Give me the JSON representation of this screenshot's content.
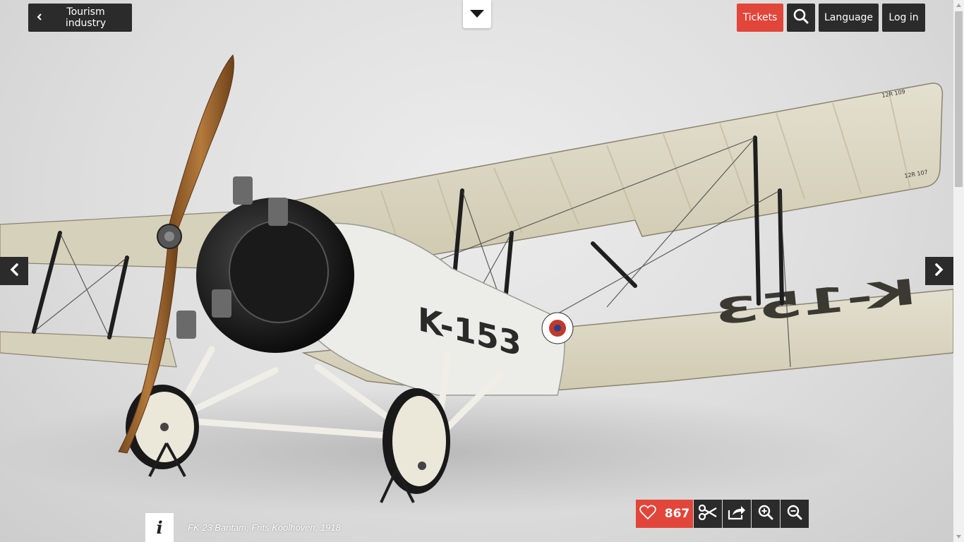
{
  "header": {
    "back_label": "Tourism industry",
    "tickets_label": "Tickets",
    "language_label": "Language",
    "login_label": "Log in"
  },
  "artwork": {
    "caption": "FK 23 Bantam, Frits Koolhoven, 1918"
  },
  "toolbar": {
    "like_count": "867"
  },
  "colors": {
    "accent": "#e2453a",
    "button_dark": "#2b2b2b"
  },
  "icons": [
    "chevron-left-icon",
    "search-icon",
    "caret-down-icon",
    "arrow-left-icon",
    "arrow-right-icon",
    "info-icon",
    "heart-icon",
    "scissors-icon",
    "share-icon",
    "zoom-in-icon",
    "zoom-out-icon"
  ]
}
